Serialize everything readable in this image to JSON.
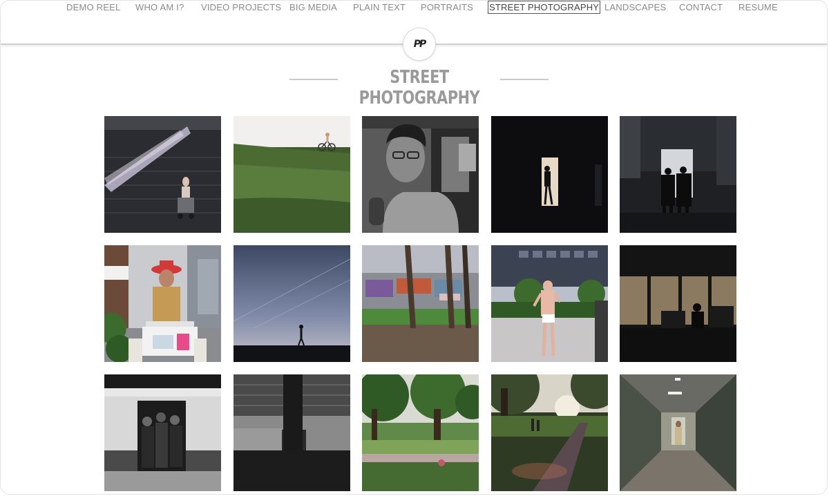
{
  "nav": {
    "items": [
      {
        "label": "DEMO REEL",
        "active": false
      },
      {
        "label": "WHO AM I?",
        "active": false
      },
      {
        "label": "VIDEO PROJECTS",
        "active": false
      },
      {
        "label": "BIG MEDIA",
        "active": false
      },
      {
        "label": "PLAIN TEXT",
        "active": false
      },
      {
        "label": "PORTRAITS",
        "active": false
      },
      {
        "label": "STREET PHOTOGRAPHY",
        "active": true
      },
      {
        "label": "LANDSCAPES",
        "active": false
      },
      {
        "label": "CONTACT",
        "active": false
      },
      {
        "label": "RESUME",
        "active": false
      }
    ]
  },
  "logo": {
    "text": "PP"
  },
  "page": {
    "title": "STREET PHOTOGRAPHY"
  },
  "gallery": {
    "photos": [
      "woman-with-stroller-light-leak",
      "cyclist-on-grass-hill",
      "man-with-glasses-subway",
      "silhouette-in-doorway",
      "two-men-silhouette-billboard",
      "woman-with-red-hat-cart",
      "person-walking-on-horizon",
      "graffiti-wall-trees-park",
      "shirtless-man-walking-plaza",
      "silhouette-office-window",
      "subway-car-open-doors",
      "station-interior-dark",
      "park-trees-field",
      "park-path-sunset",
      "tiled-tunnel-walker"
    ]
  }
}
